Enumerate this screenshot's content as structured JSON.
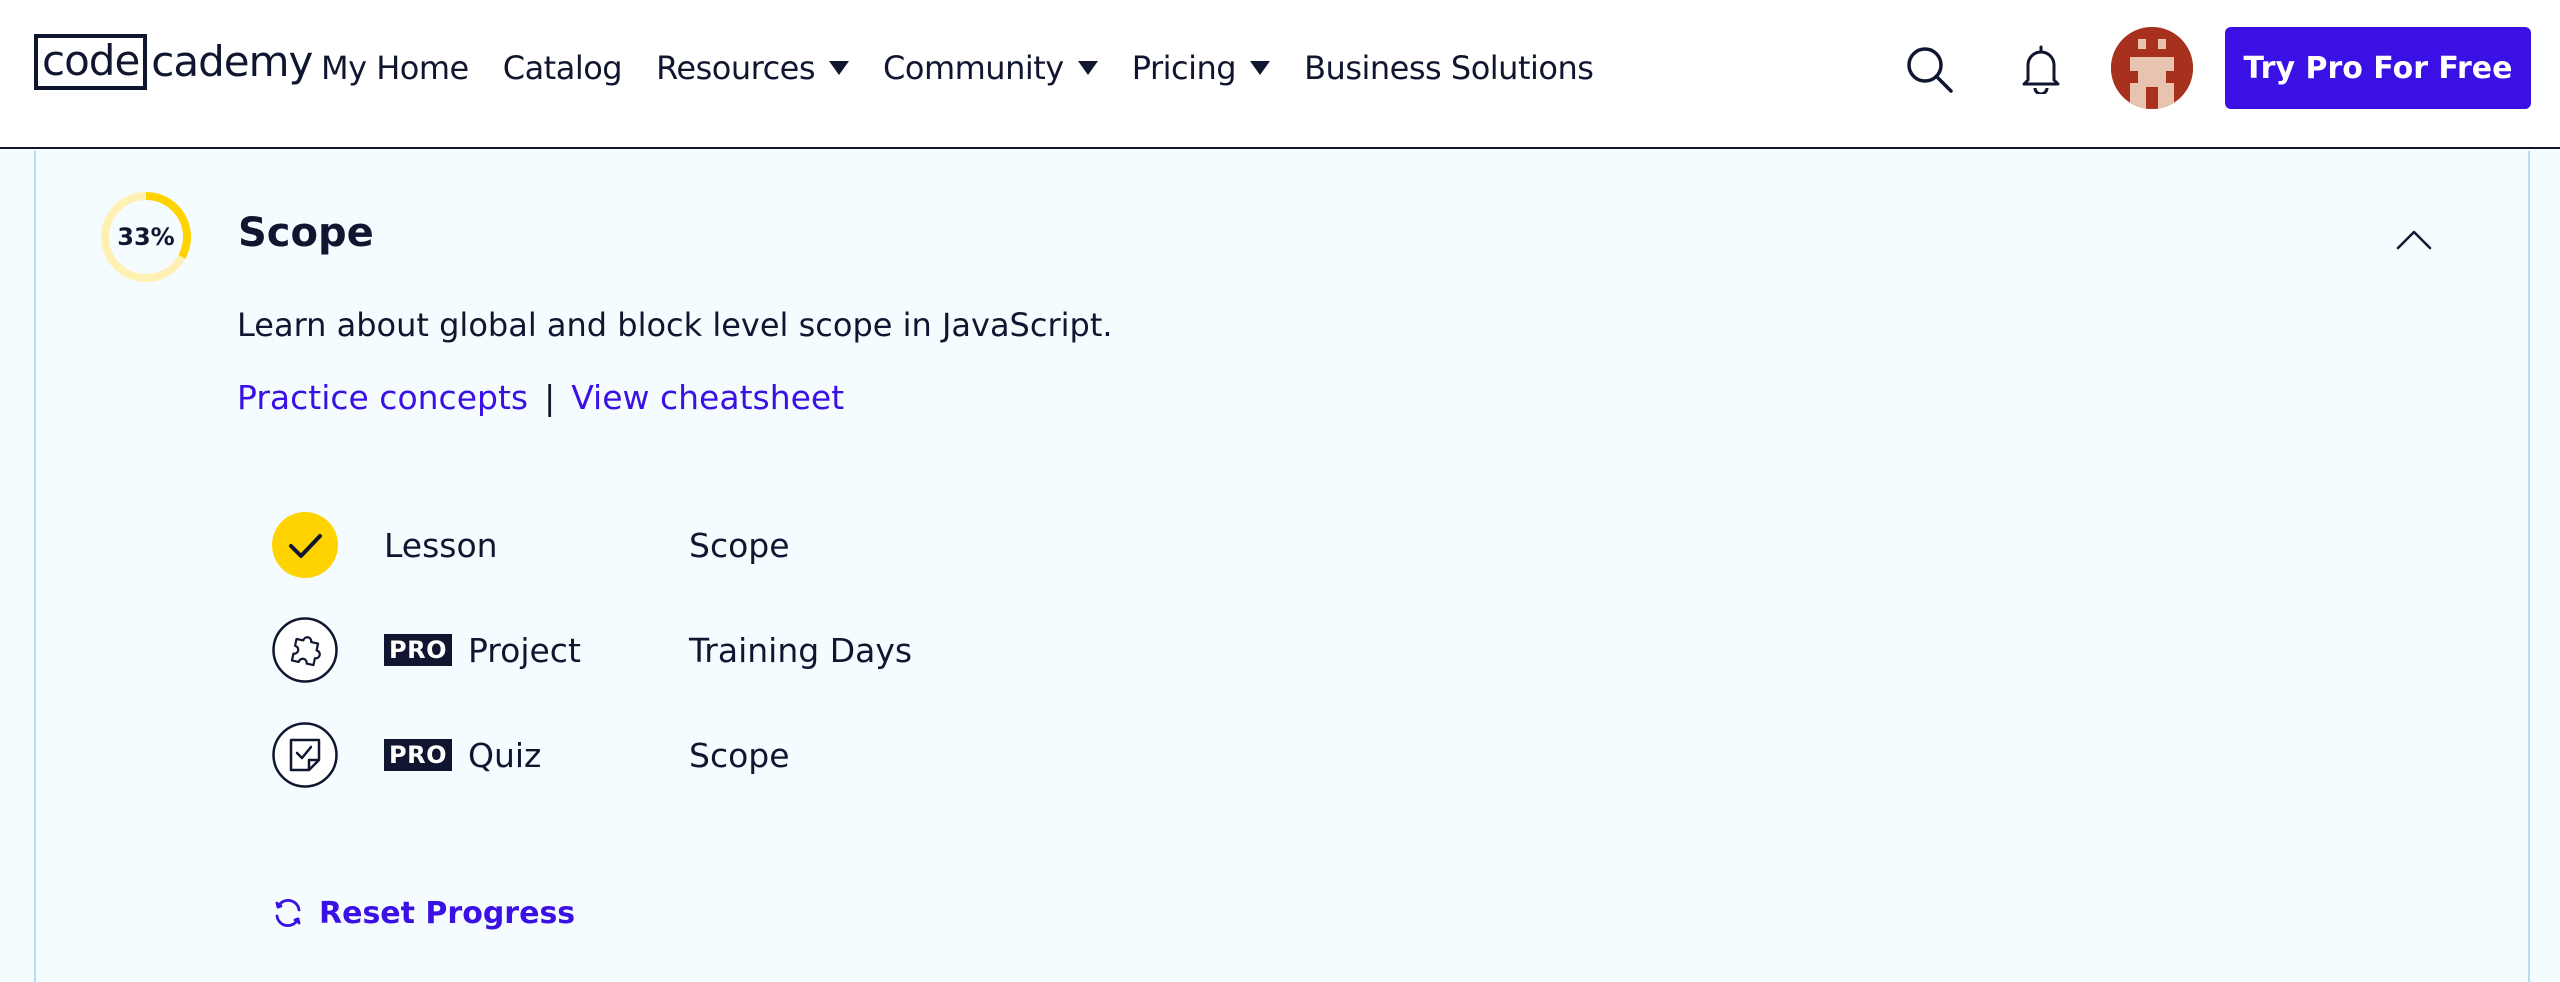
{
  "header": {
    "logo": {
      "boxed": "code",
      "rest": "cademy"
    },
    "nav": [
      {
        "label": "My Home",
        "dropdown": false
      },
      {
        "label": "Catalog",
        "dropdown": false
      },
      {
        "label": "Resources",
        "dropdown": true
      },
      {
        "label": "Community",
        "dropdown": true
      },
      {
        "label": "Pricing",
        "dropdown": true
      },
      {
        "label": "Business Solutions",
        "dropdown": false
      }
    ],
    "icons": {
      "search": "search-icon",
      "notifications": "bell-icon",
      "avatar": "pixel-avatar"
    },
    "cta_label": "Try Pro For Free"
  },
  "module": {
    "progress_percent": 33,
    "progress_label": "33%",
    "title": "Scope",
    "description": "Learn about global and block level scope in JavaScript.",
    "links": {
      "practice": "Practice concepts",
      "separator": "|",
      "cheatsheet": "View cheatsheet"
    },
    "items": [
      {
        "type": "Lesson",
        "name": "Scope",
        "pro": false,
        "completed": true,
        "icon": "check-icon"
      },
      {
        "type": "Project",
        "name": "Training Days",
        "pro": true,
        "completed": false,
        "icon": "puzzle-icon"
      },
      {
        "type": "Quiz",
        "name": "Scope",
        "pro": true,
        "completed": false,
        "icon": "quiz-icon"
      }
    ],
    "pro_badge": "PRO",
    "reset_label": "Reset Progress"
  },
  "colors": {
    "brand": "#3a10e5",
    "navy": "#10162f",
    "progress": "#ffd300",
    "progress_track": "#fff0b3",
    "panel_bg": "#f5fcff",
    "avatar_bg": "#a8311d"
  }
}
